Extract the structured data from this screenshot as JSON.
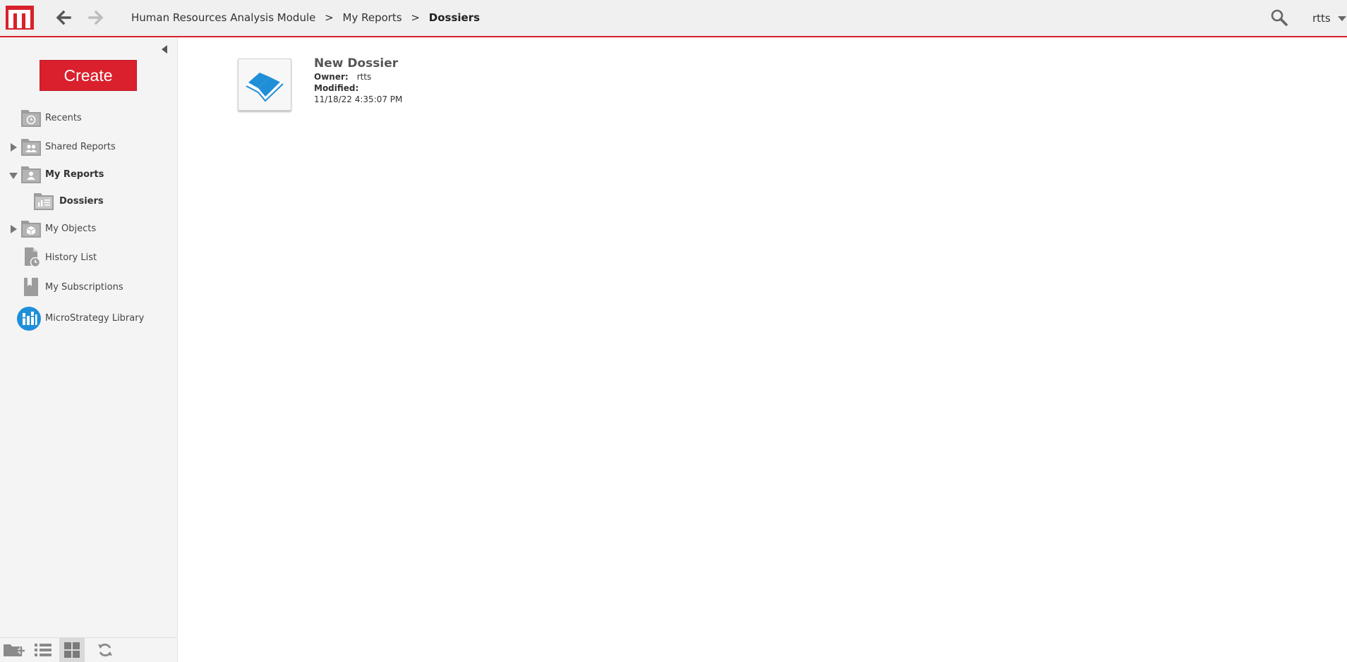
{
  "colors": {
    "brand": "#d9202c",
    "library_icon": "#1f8fd8",
    "dossier_icon": "#1f8fd8"
  },
  "header": {
    "logo_icon": "microstrategy-logo",
    "back_icon": "arrow-left-icon",
    "forward_icon": "arrow-right-icon",
    "breadcrumb": [
      {
        "label": "Human Resources Analysis Module"
      },
      {
        "label": "My Reports"
      }
    ],
    "breadcrumb_sep": ">",
    "breadcrumb_current": "Dossiers",
    "search_icon": "search-icon",
    "user": "rtts"
  },
  "sidebar": {
    "create_label": "Create",
    "items": [
      {
        "label": "Recents",
        "icon": "recents-folder-icon"
      },
      {
        "label": "Shared Reports",
        "icon": "shared-folder-icon",
        "expander": "collapsed"
      },
      {
        "label": "My Reports",
        "icon": "my-reports-folder-icon",
        "expander": "expanded"
      },
      {
        "label": "Dossiers",
        "icon": "dossier-folder-icon"
      },
      {
        "label": "My Objects",
        "icon": "objects-folder-icon",
        "expander": "collapsed"
      },
      {
        "label": "History List",
        "icon": "history-list-icon"
      },
      {
        "label": "My Subscriptions",
        "icon": "subscriptions-icon"
      },
      {
        "label": "MicroStrategy Library",
        "icon": "library-icon"
      }
    ],
    "footer": [
      "new-folder-icon",
      "list-view-icon",
      "grid-view-icon",
      "refresh-icon"
    ]
  },
  "main": {
    "items": [
      {
        "title": "New Dossier",
        "owner_label": "Owner:",
        "owner": "rtts",
        "modified_label": "Modified:",
        "modified": "11/18/22 4:35:07 PM",
        "icon": "dossier-icon"
      }
    ]
  }
}
